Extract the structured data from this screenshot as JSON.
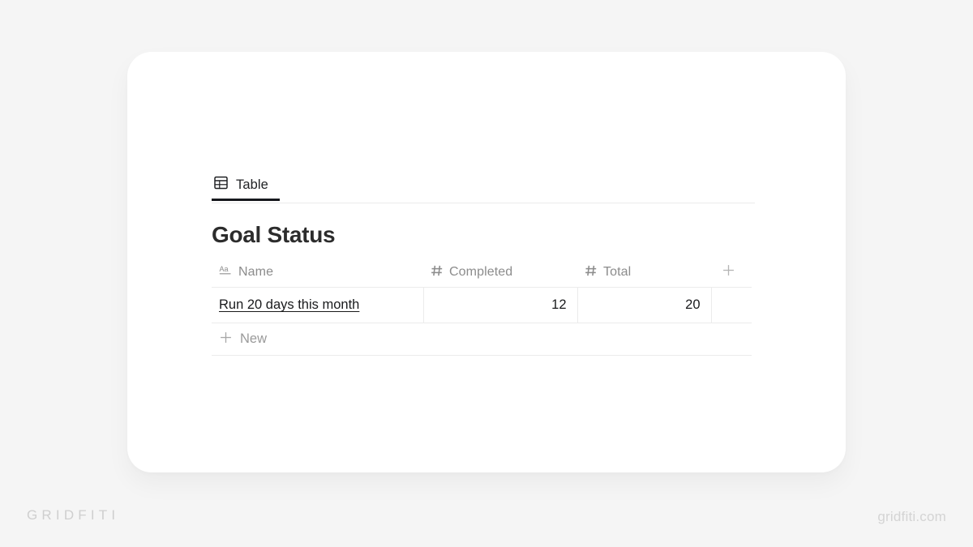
{
  "watermarks": {
    "brand": "GRIDFITI",
    "site": "gridfiti.com"
  },
  "card": {
    "tabs": [
      {
        "label": "Table",
        "icon": "table-icon",
        "active": true
      }
    ],
    "database": {
      "title": "Goal Status",
      "columns": [
        {
          "label": "Name",
          "icon": "text-property-icon",
          "type": "title"
        },
        {
          "label": "Completed",
          "icon": "number-property-icon",
          "type": "number"
        },
        {
          "label": "Total",
          "icon": "number-property-icon",
          "type": "number"
        }
      ],
      "add_column_icon": "plus-icon",
      "rows": [
        {
          "name": "Run 20 days this month",
          "completed": "12",
          "total": "20"
        }
      ],
      "new_row_label": "New",
      "new_row_icon": "plus-icon"
    }
  },
  "colors": {
    "page_background": "#f5f5f5",
    "card_background": "#ffffff",
    "text_primary": "#191a1c",
    "text_muted": "#8c8c8c",
    "border": "#ebebeb",
    "tab_active_underline": "#16181d",
    "watermark": "#cfcfcf"
  }
}
